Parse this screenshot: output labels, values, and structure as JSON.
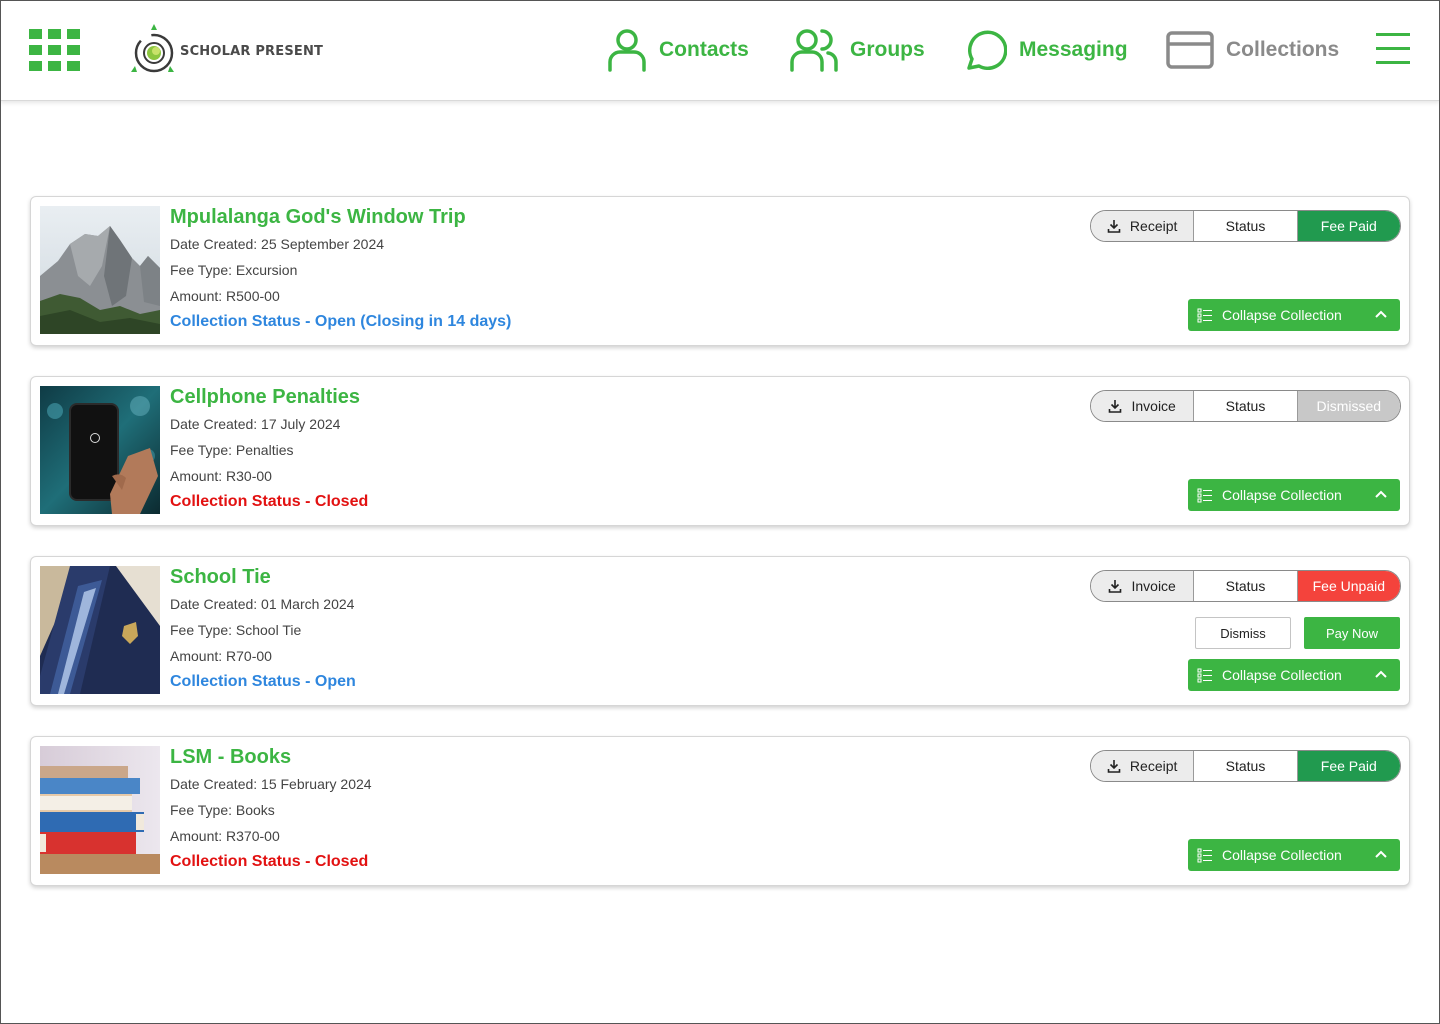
{
  "header": {
    "logo_text": "SCHOLAR PRESENT",
    "nav": [
      {
        "label": "Contacts",
        "icon": "user-icon"
      },
      {
        "label": "Groups",
        "icon": "users-icon"
      },
      {
        "label": "Messaging",
        "icon": "chat-bubble-icon"
      },
      {
        "label": "Collections",
        "icon": "card-icon"
      }
    ],
    "accent_color": "#3cb543",
    "muted_color": "#8a8a8a"
  },
  "collections": [
    {
      "title": "Mpulalanga God's Window Trip",
      "date_created": "Date Created: 25 September 2024",
      "fee_type": "Fee Type: Excursion",
      "amount": "Amount: R500-00",
      "status_text": "Collection Status - Open (Closing in 14 days)",
      "status_kind": "open",
      "doc_button": "Receipt",
      "status_label": "Status",
      "fee_state": "Fee Paid",
      "fee_state_kind": "paid",
      "collapse_label": "Collapse Collection",
      "image": "mountain-photo"
    },
    {
      "title": "Cellphone Penalties",
      "date_created": "Date Created: 17 July 2024",
      "fee_type": "Fee Type: Penalties",
      "amount": "Amount: R30-00",
      "status_text": "Collection Status - Closed",
      "status_kind": "closed",
      "doc_button": "Invoice",
      "status_label": "Status",
      "fee_state": "Dismissed",
      "fee_state_kind": "dismissed",
      "collapse_label": "Collapse Collection",
      "image": "cellphone-photo"
    },
    {
      "title": "School Tie",
      "date_created": "Date Created: 01 March 2024",
      "fee_type": "Fee Type: School Tie",
      "amount": "Amount: R70-00",
      "status_text": "Collection Status - Open",
      "status_kind": "open",
      "doc_button": "Invoice",
      "status_label": "Status",
      "fee_state": "Fee Unpaid",
      "fee_state_kind": "unpaid",
      "dismiss_label": "Dismiss",
      "pay_now_label": "Pay Now",
      "collapse_label": "Collapse Collection",
      "image": "school-tie-photo"
    },
    {
      "title": "LSM - Books",
      "date_created": "Date Created: 15 February 2024",
      "fee_type": "Fee Type: Books",
      "amount": "Amount: R370-00",
      "status_text": "Collection Status - Closed",
      "status_kind": "closed",
      "doc_button": "Receipt",
      "status_label": "Status",
      "fee_state": "Fee Paid",
      "fee_state_kind": "paid",
      "collapse_label": "Collapse Collection",
      "image": "books-photo"
    }
  ],
  "colors": {
    "open_status": "#2e86de",
    "closed_status": "#e21111",
    "paid": "#219a4f",
    "dismissed": "#c8c8c8",
    "unpaid": "#f4433c"
  }
}
